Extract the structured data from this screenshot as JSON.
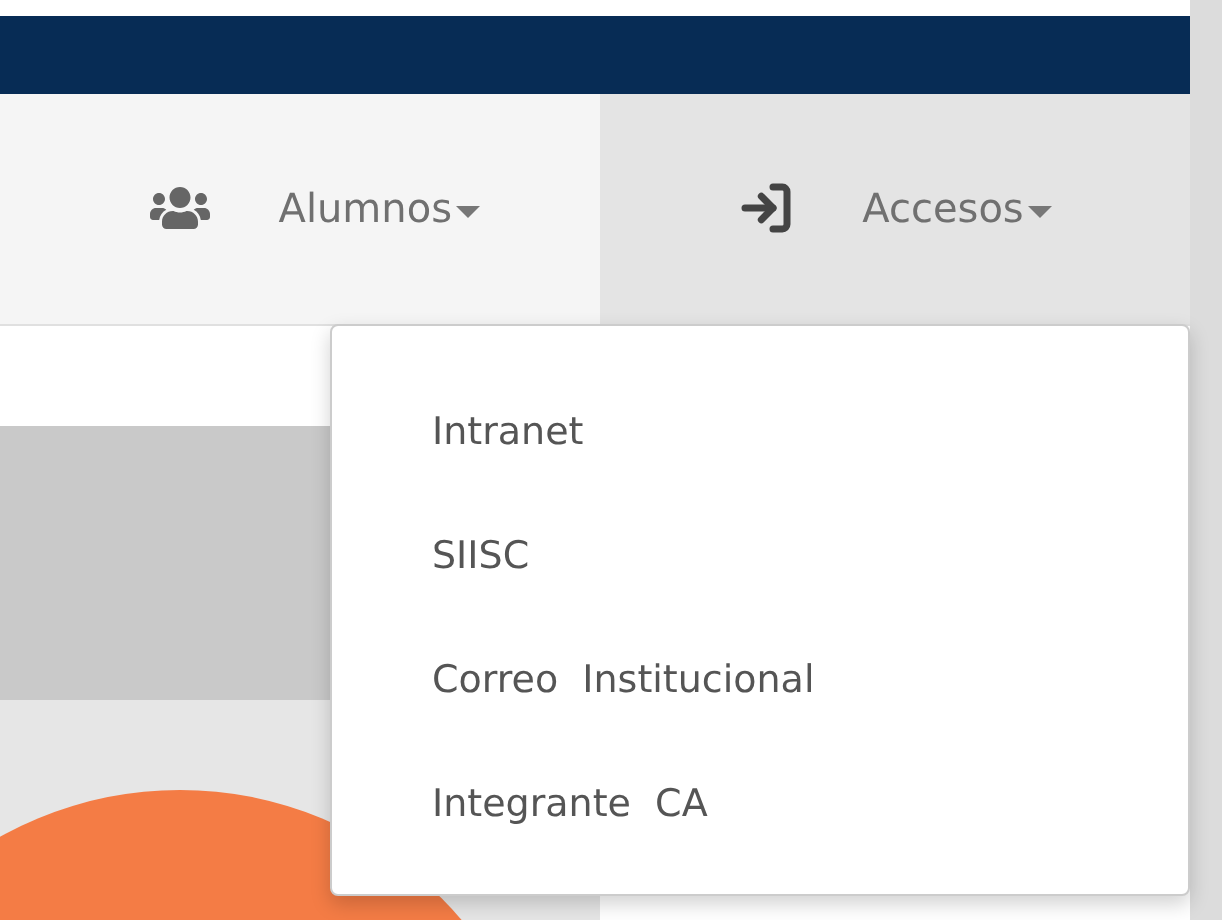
{
  "nav": {
    "items": [
      {
        "label": "Alumnos",
        "expanded": false
      },
      {
        "label": "Accesos",
        "expanded": true,
        "menu": [
          "Intranet",
          "SIISC",
          "Correo  Institucional",
          "Integrante  CA"
        ]
      }
    ]
  }
}
